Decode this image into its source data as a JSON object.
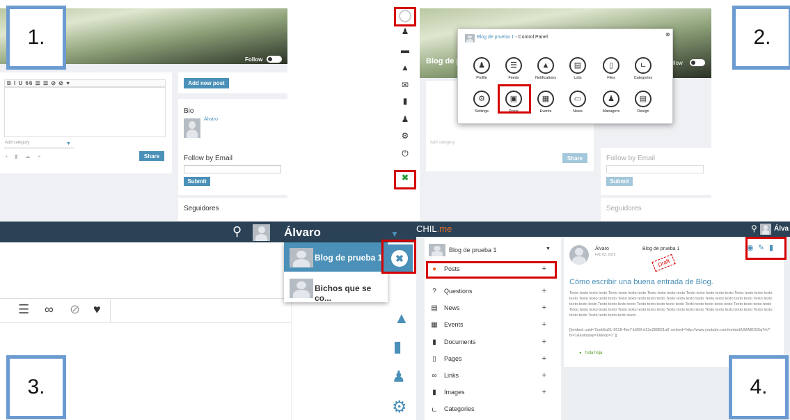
{
  "steps": {
    "step1": "1.",
    "step2": "2.",
    "step3": "3.",
    "step4": "4."
  },
  "panel1": {
    "follow_label": "Follow",
    "toolbar_text": "B  I  U  66  ☰  ☰  ⊘  ⊘  ♥",
    "add_category": "Add category",
    "share_label": "Share",
    "add_new_post": "Add new post",
    "bio_label": "Bio",
    "bio_user": "Álvaro",
    "follow_email_label": "Follow by Email",
    "submit_label": "Submit",
    "followers_label": "Seguidores"
  },
  "vertical_icons": [
    "person-icon",
    "chat-icon",
    "bell-icon",
    "mail-icon",
    "pages-icon",
    "users-icon",
    "gear-icon",
    "power-icon",
    "tools-icon"
  ],
  "panel2": {
    "dialog_title": "Blog de prueba 1",
    "dialog_title_suffix": " - Control Panel",
    "blog_name_partial": "Blog de pr",
    "follow_partial": "llow",
    "follow_email_label": "Follow by Email",
    "submit_label": "Submit",
    "followers_label": "Seguidores",
    "share_label": "Share",
    "add_category": "Add category",
    "row1": [
      "Profile",
      "Feeds",
      "Notifications",
      "Lists",
      "Files",
      "Categories"
    ],
    "row2": [
      "Settings",
      "Posts",
      "Events",
      "News",
      "Managers",
      "Design"
    ]
  },
  "panel3": {
    "user_name": "Álvaro",
    "blog_1": "Blog de prueba 1",
    "blog_2": "Bichos que se co..."
  },
  "panel4": {
    "app_name": "CHIL",
    "app_suffix": ".me",
    "user_partial": "Álva",
    "blog_select": "Blog de prueba 1",
    "menu": [
      "Posts",
      "Questions",
      "News",
      "Events",
      "Documents",
      "Pages",
      "Links",
      "Images",
      "Categories"
    ],
    "post_author": "Álvaro",
    "post_blog": "Blog de prueba 1",
    "post_date": "Feb 02, 2016",
    "draft_stamp": "Draft",
    "post_title": "Cómo escribir una buena entrada de Blog.",
    "post_body": "Texto texto texto texto  Texto texto texto texto Texto texto texto texto Texto texto texto texto texto Texto texto texto texto texto Texto texto texto texto Texto texto texto texto texto Texto texto texto texto Texto texto texto texto texto Texto texto texto texto texto Texto texto texto texto Texto texto texto texto texto Texto texto texto texto texto Texto texto texto texto Texto texto texto texto texto Texto texto texto texto texto Texto texto texto texto Texto texto texto texto texto Texto texto texto texto Texto texto texto texto texto.",
    "embed_text": "[[embed uuid='2ceb5a51-2618-4be7-b969-d13e289821a0' embed='http://www.youtube.com/embed/UMA8CG5q?rk?fs=1&autoplay=1&loop=1' ]]",
    "tag": "hola hoja"
  }
}
